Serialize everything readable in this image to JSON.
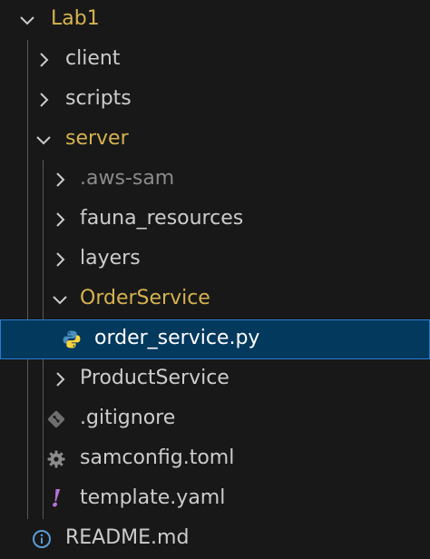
{
  "explorer": {
    "items": [
      {
        "label": "Lab1",
        "type": "folder",
        "expanded": true,
        "depth": 0,
        "icon": "chevron-down-icon"
      },
      {
        "label": "client",
        "type": "folder",
        "expanded": false,
        "depth": 1,
        "icon": "chevron-right-icon"
      },
      {
        "label": "scripts",
        "type": "folder",
        "expanded": false,
        "depth": 1,
        "icon": "chevron-right-icon"
      },
      {
        "label": "server",
        "type": "folder",
        "expanded": true,
        "depth": 1,
        "icon": "chevron-down-icon"
      },
      {
        "label": ".aws-sam",
        "type": "folder",
        "expanded": false,
        "depth": 2,
        "icon": "chevron-right-icon"
      },
      {
        "label": "fauna_resources",
        "type": "folder",
        "expanded": false,
        "depth": 2,
        "icon": "chevron-right-icon"
      },
      {
        "label": "layers",
        "type": "folder",
        "expanded": false,
        "depth": 2,
        "icon": "chevron-right-icon"
      },
      {
        "label": "OrderService",
        "type": "folder",
        "expanded": true,
        "depth": 2,
        "icon": "chevron-down-icon"
      },
      {
        "label": "order_service.py",
        "type": "file",
        "selected": true,
        "depth": 3,
        "icon": "python-icon"
      },
      {
        "label": "ProductService",
        "type": "folder",
        "expanded": false,
        "depth": 2,
        "icon": "chevron-right-icon"
      },
      {
        "label": ".gitignore",
        "type": "file",
        "depth": 2,
        "icon": "git-icon"
      },
      {
        "label": "samconfig.toml",
        "type": "file",
        "depth": 2,
        "icon": "gear-icon"
      },
      {
        "label": "template.yaml",
        "type": "file",
        "depth": 2,
        "icon": "exclamation-icon"
      },
      {
        "label": "README.md",
        "type": "file",
        "depth": 1,
        "icon": "info-icon"
      }
    ]
  },
  "colors": {
    "background": "#181818",
    "selection": "#04395e",
    "selection_border": "#2b7ccf",
    "expanded_folder_text": "#d5b24f",
    "text": "#cccccc",
    "dimmed_text": "#8b8b8b",
    "python_blue": "#4b8bbe",
    "python_yellow": "#ffd43b",
    "yaml_purple": "#b772d6",
    "info_blue": "#5a9bd6"
  }
}
